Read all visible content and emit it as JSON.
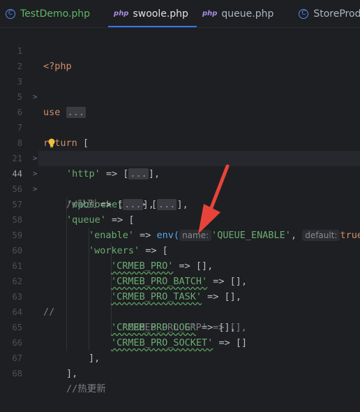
{
  "tabs": [
    {
      "icon": "C",
      "label": "TestDemo.php"
    },
    {
      "icon": "php",
      "label": "swoole.php"
    },
    {
      "icon": "php",
      "label": "queue.php"
    },
    {
      "icon": "C",
      "label": "StoreProdu"
    }
  ],
  "hints": {
    "name": "name:",
    "default": "default:"
  },
  "lines": [
    {
      "num": "1",
      "t": "<?php"
    },
    {
      "num": "2",
      "t": ""
    },
    {
      "num": "3",
      "kw": "use ",
      "col": "..."
    },
    {
      "num": "5",
      "t": ""
    },
    {
      "num": "6",
      "t": ""
    },
    {
      "num": "7",
      "kw": "return ",
      "t": "["
    },
    {
      "num": "8",
      "s": "'http'",
      "mid": " => [",
      "col": "...",
      "end": "],"
    },
    {
      "num": "21",
      "s": "'websocket'",
      "mid": " => [",
      "col": "...",
      "end": "],"
    },
    {
      "num": "44",
      "s": "'rpc'",
      "mid": " => [",
      "col": "...",
      "end": "],"
    },
    {
      "num": "56",
      "c": "//队列"
    },
    {
      "num": "57",
      "s": "'queue'",
      "mid": " => ["
    },
    {
      "num": "58",
      "s": "'enable'",
      "mid": " => ",
      "fn": "env(",
      "s2": "'QUEUE_ENABLE'",
      "mid2": ", ",
      "s3": "true"
    },
    {
      "num": "59",
      "s": "'workers'",
      "mid": " => ["
    },
    {
      "num": "60",
      "s": "'CRMEB_PRO'",
      "mid": " => [],"
    },
    {
      "num": "61",
      "s": "'CRMEB_PRO_BATCH'",
      "mid": " => [],"
    },
    {
      "num": "62",
      "s": "'CRMEB_PRO_TASK'",
      "mid": " => [],"
    },
    {
      "num": "63",
      "c": "//",
      "c2": "'CRMEB_PRO_ERP' => [],"
    },
    {
      "num": "64",
      "s": "'CRMEB_PRO_LOG'",
      "mid": " => [],"
    },
    {
      "num": "65",
      "s": "'CRMEB_PRO_SOCKET'",
      "mid": " => []"
    },
    {
      "num": "66",
      "t": "],"
    },
    {
      "num": "67",
      "t": "],"
    },
    {
      "num": "68",
      "c": "//热更新"
    }
  ]
}
